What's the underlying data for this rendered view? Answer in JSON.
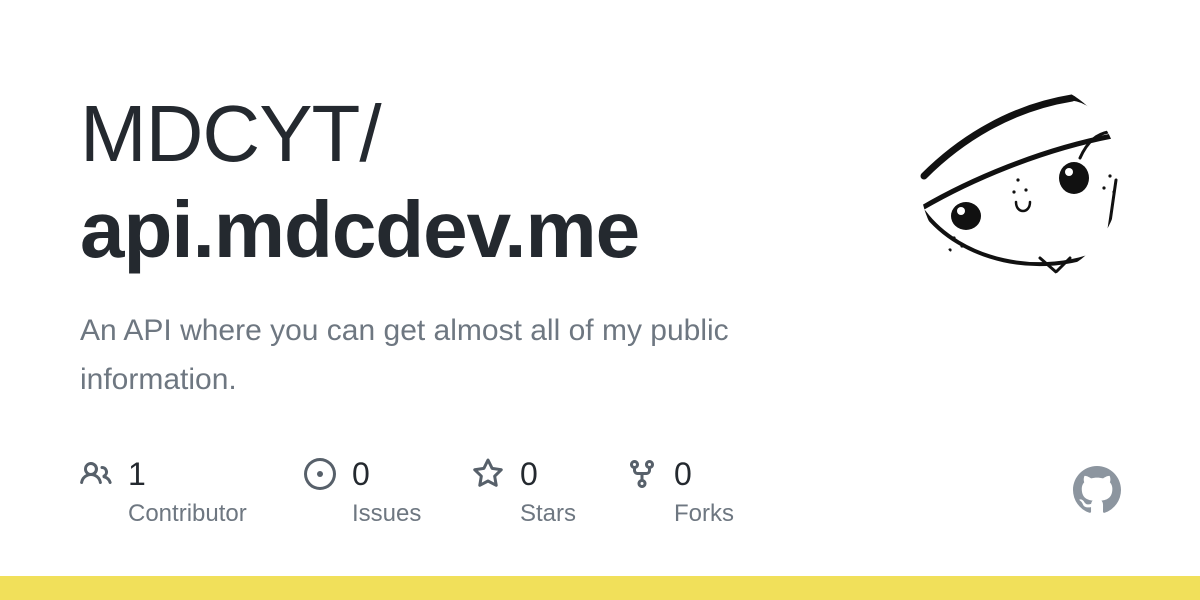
{
  "repo": {
    "owner": "MDCYT/",
    "name": "api.mdcdev.me",
    "description": "An API where you can get almost all of my public information."
  },
  "stats": [
    {
      "icon": "people-icon",
      "value": "1",
      "label": "Contributor"
    },
    {
      "icon": "issue-opened-icon",
      "value": "0",
      "label": "Issues"
    },
    {
      "icon": "star-icon",
      "value": "0",
      "label": "Stars"
    },
    {
      "icon": "repo-forked-icon",
      "value": "0",
      "label": "Forks"
    }
  ],
  "colors": {
    "title": "#24292f",
    "muted": "#6e7781",
    "icon": "#57606a",
    "github_logo": "#8c959f",
    "language_bar": "#f1e05a"
  }
}
